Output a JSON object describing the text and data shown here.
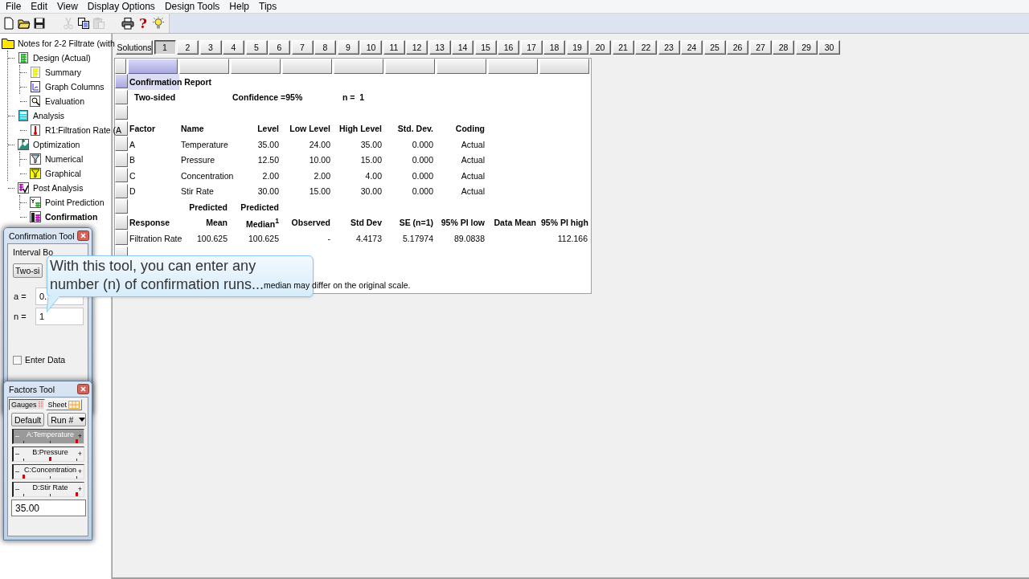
{
  "menu": [
    "File",
    "Edit",
    "View",
    "Display Options",
    "Design Tools",
    "Help",
    "Tips"
  ],
  "toolbar": [
    {
      "kind": "new",
      "disabled": false
    },
    {
      "kind": "open",
      "disabled": false
    },
    {
      "kind": "save",
      "disabled": false
    },
    {
      "kind": "cut",
      "disabled": true
    },
    {
      "kind": "copy",
      "disabled": false
    },
    {
      "kind": "paste",
      "disabled": true
    },
    {
      "kind": "print",
      "disabled": false
    },
    {
      "kind": "help",
      "text": "?",
      "disabled": false
    },
    {
      "kind": "tip",
      "disabled": false
    }
  ],
  "tree": [
    {
      "label": "Notes for 2-2 Filtrate (with",
      "kind": "notes",
      "selected": false,
      "children": [
        {
          "label": "Design (Actual)",
          "kind": "design",
          "selected": false,
          "children": [
            {
              "label": "Summary",
              "kind": "summary",
              "selected": false
            },
            {
              "label": "Graph Columns",
              "kind": "graph",
              "selected": false
            },
            {
              "label": "Evaluation",
              "kind": "evaluation",
              "selected": false
            }
          ]
        },
        {
          "label": "Analysis",
          "kind": "analysis",
          "selected": false,
          "children": [
            {
              "label": "R1:Filtration Rate (A",
              "kind": "response",
              "selected": false
            }
          ]
        },
        {
          "label": "Optimization",
          "kind": "optimization",
          "selected": false,
          "children": [
            {
              "label": "Numerical",
              "kind": "numerical",
              "selected": false
            },
            {
              "label": "Graphical",
              "kind": "graphical",
              "selected": false
            }
          ]
        },
        {
          "label": "Post Analysis",
          "kind": "post",
          "selected": false,
          "children": [
            {
              "label": "Point Prediction",
              "kind": "point",
              "selected": false
            },
            {
              "label": "Confirmation",
              "kind": "confirmation",
              "selected": true
            }
          ]
        }
      ]
    }
  ],
  "solutions": {
    "label": "Solutions",
    "tabs": [
      {
        "label": "1",
        "selected": true
      },
      {
        "label": "2",
        "selected": false
      },
      {
        "label": "3",
        "selected": false
      },
      {
        "label": "4",
        "selected": false
      },
      {
        "label": "5",
        "selected": false
      },
      {
        "label": "6",
        "selected": false
      },
      {
        "label": "7",
        "selected": false
      },
      {
        "label": "8",
        "selected": false
      },
      {
        "label": "9",
        "selected": false
      },
      {
        "label": "10",
        "selected": false
      },
      {
        "label": "11",
        "selected": false
      },
      {
        "label": "12",
        "selected": false
      },
      {
        "label": "13",
        "selected": false
      },
      {
        "label": "14",
        "selected": false
      },
      {
        "label": "15",
        "selected": false
      },
      {
        "label": "16",
        "selected": false
      },
      {
        "label": "17",
        "selected": false
      },
      {
        "label": "18",
        "selected": false
      },
      {
        "label": "19",
        "selected": false
      },
      {
        "label": "20",
        "selected": false
      },
      {
        "label": "21",
        "selected": false
      },
      {
        "label": "22",
        "selected": false
      },
      {
        "label": "23",
        "selected": false
      },
      {
        "label": "24",
        "selected": false
      },
      {
        "label": "25",
        "selected": false
      },
      {
        "label": "26",
        "selected": false
      },
      {
        "label": "27",
        "selected": false
      },
      {
        "label": "28",
        "selected": false
      },
      {
        "label": "29",
        "selected": false
      },
      {
        "label": "30",
        "selected": false
      }
    ]
  },
  "report": {
    "title": "Confirmation Report",
    "title_selected": true,
    "bound": "Two-sided",
    "confidence": "Confidence =95%",
    "n": "n =  1",
    "factor_columns": [
      "Factor",
      "Name",
      "Level",
      "Low Level",
      "High Level",
      "Std. Dev.",
      "Coding"
    ],
    "factors": [
      {
        "factor": "A",
        "name": "Temperature",
        "level": "35.00",
        "low": "24.00",
        "high": "35.00",
        "std_dev": "0.000",
        "coding": "Actual"
      },
      {
        "factor": "B",
        "name": "Pressure",
        "level": "12.50",
        "low": "10.00",
        "high": "15.00",
        "std_dev": "0.000",
        "coding": "Actual"
      },
      {
        "factor": "C",
        "name": "Concentration",
        "level": "2.00",
        "low": "2.00",
        "high": "4.00",
        "std_dev": "0.000",
        "coding": "Actual"
      },
      {
        "factor": "D",
        "name": "Stir Rate",
        "level": "30.00",
        "low": "15.00",
        "high": "30.00",
        "std_dev": "0.000",
        "coding": "Actual"
      }
    ],
    "predicted_labels": [
      "Predicted",
      "Predicted"
    ],
    "response_columns": [
      "Response",
      "Mean",
      "Median$^{1}$",
      "Observed",
      "Std Dev",
      "SE (n=1)",
      "95% PI low",
      "Data Mean",
      "95% PI high"
    ],
    "responses": [
      {
        "response": "Filtration Rate",
        "mean": "100.625",
        "median": "100.625",
        "observed": "-",
        "std_dev": "4.4173",
        "se": "5.17974",
        "pi_low": "89.0838",
        "pi_high": "112.166"
      }
    ],
    "footnote": "median may differ on the original scale."
  },
  "confirmation_tool": {
    "title": "Confirmation Tool",
    "interval_label": "Interval Bo",
    "bound": "Two-si",
    "a_label": "a =",
    "a_value": "0.",
    "n_label": "n =",
    "n_value": "1",
    "enter_data": {
      "label": "Enter Data",
      "checked": false
    }
  },
  "factors_tool": {
    "title": "Factors Tool",
    "tabs": [
      {
        "label": "Gauges",
        "selected": true
      },
      {
        "label": "Sheet",
        "selected": false
      }
    ],
    "default_button": "Default",
    "run_dropdown": "Run #",
    "gauges": [
      {
        "label": "A:Temperature",
        "minus": "–",
        "plus": "+",
        "level": 1,
        "selected": true
      },
      {
        "label": "B:Pressure",
        "minus": "–",
        "plus": "+",
        "level": 0.5,
        "selected": false
      },
      {
        "label": "C:Concentration",
        "minus": "–",
        "plus": "+",
        "level": 0,
        "selected": false
      },
      {
        "label": "D:Stir Rate",
        "minus": "–",
        "plus": "+",
        "level": 1,
        "selected": false
      }
    ],
    "value": "35.00"
  },
  "callout": {
    "text": "With this tool, you can enter any number (n) of confirmation runs..."
  }
}
